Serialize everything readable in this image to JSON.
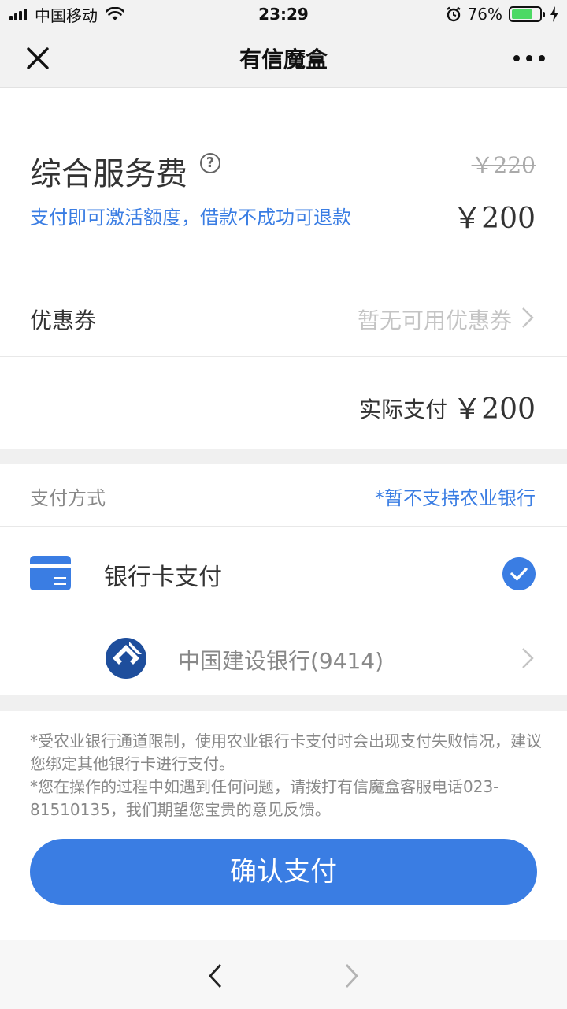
{
  "status_bar": {
    "carrier": "中国移动",
    "time": "23:29",
    "battery": "76%",
    "battery_level": 0.76,
    "icons": [
      "signal-icon",
      "wifi-icon",
      "alarm-icon",
      "battery-icon",
      "charging-icon"
    ]
  },
  "nav": {
    "title": "有信魔盒",
    "icons": [
      "close-icon",
      "more-icon"
    ]
  },
  "fee": {
    "title": "综合服务费",
    "help_symbol": "?",
    "original_price": "￥220",
    "subtitle": "支付即可激活额度，借款不成功可退款",
    "price": "￥200"
  },
  "coupon": {
    "label": "优惠券",
    "value": "暂无可用优惠券"
  },
  "actual": {
    "label": "实际支付",
    "price": "￥200"
  },
  "payment": {
    "label": "支付方式",
    "note": "*暂不支持农业银行",
    "method_label": "银行卡支付",
    "method_selected": true,
    "bank_label": "中国建设银行(9414)"
  },
  "notes": {
    "line1": "*受农业银行通道限制，使用农业银行卡支付时会出现支付失败情况，建议您绑定其他银行卡进行支付。",
    "line2": "*您在操作的过程中如遇到任何问题，请拨打有信魔盒客服电话023-81510135，我们期望您宝贵的意见反馈。"
  },
  "confirm_button": "确认支付",
  "colors": {
    "accent": "#3a7de3",
    "ccb_blue": "#1e4e9c",
    "battery_green": "#4cd964"
  }
}
